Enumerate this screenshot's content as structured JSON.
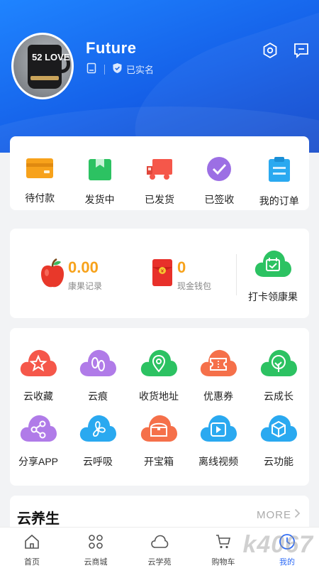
{
  "profile": {
    "username": "Future",
    "verified_label": "已实名",
    "avatar_text": "52 LOVE"
  },
  "orders": [
    {
      "label": "待付款",
      "icon": "wallet-icon"
    },
    {
      "label": "发货中",
      "icon": "package-icon"
    },
    {
      "label": "已发货",
      "icon": "truck-icon"
    },
    {
      "label": "已签收",
      "icon": "check-circle-icon"
    },
    {
      "label": "我的订单",
      "icon": "order-list-icon"
    }
  ],
  "wallet": {
    "kangguo_value": "0.00",
    "kangguo_label": "康果记录",
    "cash_value": "0",
    "cash_label": "现金钱包",
    "cash_badge": "¥",
    "checkin_label": "打卡领康果"
  },
  "tools": [
    {
      "label": "云收藏",
      "icon": "star-icon",
      "color": "#f5574a"
    },
    {
      "label": "云痕",
      "icon": "footprint-icon",
      "color": "#b07be8"
    },
    {
      "label": "收货地址",
      "icon": "location-icon",
      "color": "#2cc262"
    },
    {
      "label": "优惠券",
      "icon": "coupon-icon",
      "color": "#f5704a"
    },
    {
      "label": "云成长",
      "icon": "sprout-icon",
      "color": "#2cc262"
    },
    {
      "label": "分享APP",
      "icon": "share-icon",
      "color": "#b07be8"
    },
    {
      "label": "云呼吸",
      "icon": "fan-icon",
      "color": "#2aa9f0"
    },
    {
      "label": "开宝箱",
      "icon": "treasure-chest-icon",
      "color": "#f5704a"
    },
    {
      "label": "离线视频",
      "icon": "video-icon",
      "color": "#2aa9f0"
    },
    {
      "label": "云功能",
      "icon": "cube-icon",
      "color": "#2aa9f0"
    }
  ],
  "health": {
    "title": "云养生",
    "more_label": "MORE"
  },
  "tabs": [
    {
      "label": "首页",
      "icon": "home-icon"
    },
    {
      "label": "云商城",
      "icon": "grid-icon"
    },
    {
      "label": "云学苑",
      "icon": "cloud-icon"
    },
    {
      "label": "购物车",
      "icon": "cart-icon"
    },
    {
      "label": "我的",
      "icon": "profile-icon"
    }
  ],
  "watermark": "k4067",
  "colors": {
    "header_blue": "#1560e8",
    "accent_orange": "#f7a21b",
    "active_tab": "#2f6cf6"
  }
}
